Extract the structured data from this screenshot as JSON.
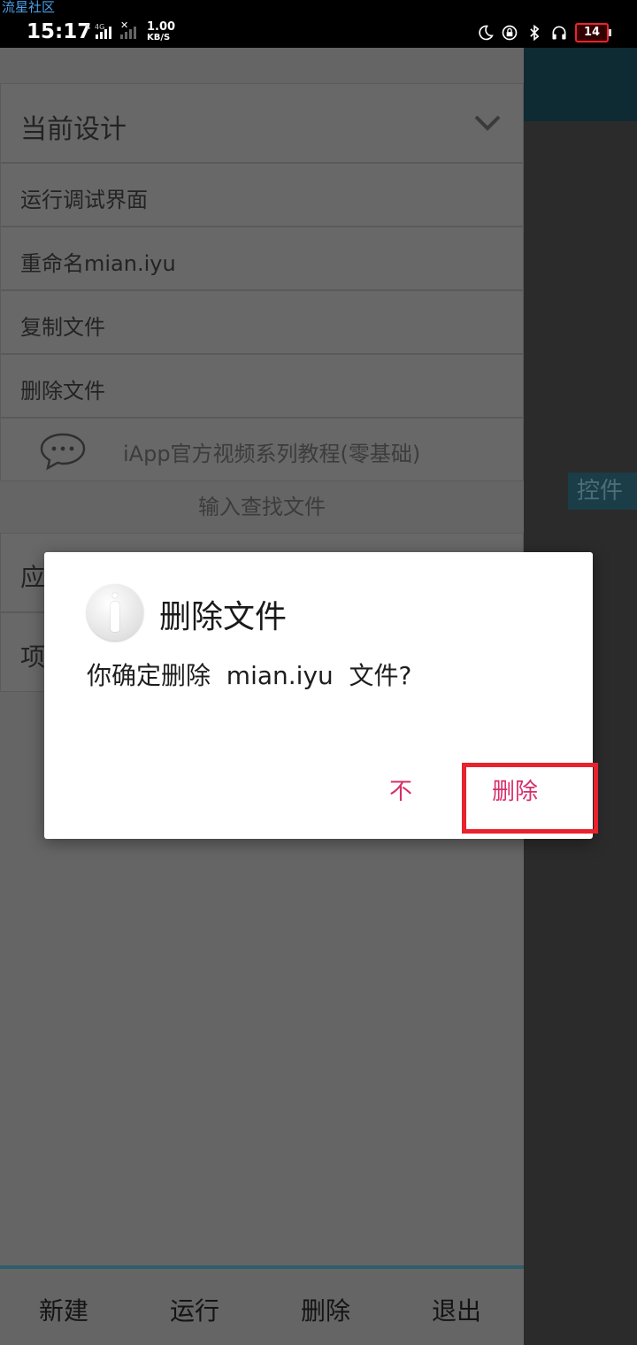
{
  "watermark": "流星社区",
  "status": {
    "time": "15:17",
    "network_type": "4G",
    "speed_value": "1.00",
    "speed_unit": "KB/S",
    "battery": "14"
  },
  "drawer": {
    "header": "当前设计",
    "items": [
      "运行调试界面",
      "重命名mian.iyu",
      "复制文件",
      "删除文件"
    ],
    "promo": "iApp官方视频系列教程(零基础)",
    "search": "输入查找文件",
    "section_a": "应",
    "section_b": "项"
  },
  "right_pane": {
    "partial_label": "控件"
  },
  "bottom_bar": {
    "new": "新建",
    "run": "运行",
    "delete": "删除",
    "exit": "退出"
  },
  "dialog": {
    "title": "删除文件",
    "message": "你确定删除  mian.iyu  文件?",
    "negative": "不",
    "positive": "删除"
  },
  "colors": {
    "dialog_button": "#d6306a",
    "highlight": "#e8232d",
    "accent_bar": "#2f5d6c"
  }
}
